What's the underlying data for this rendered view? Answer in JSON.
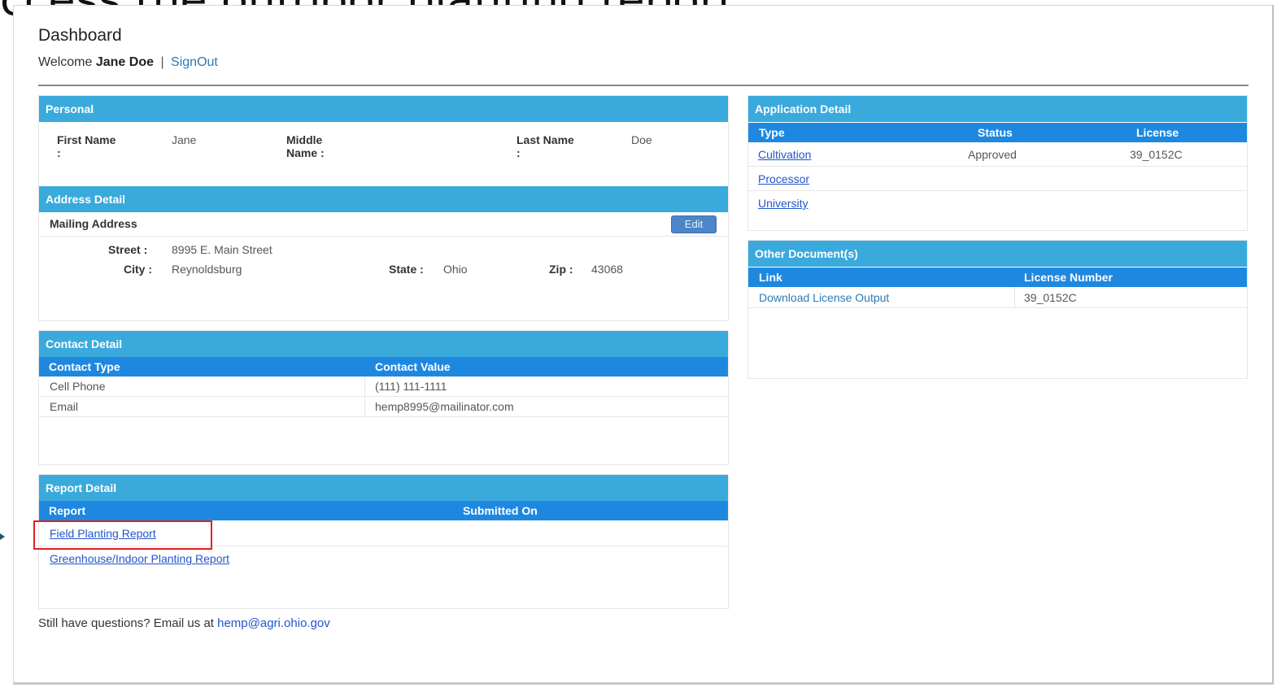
{
  "slide": {
    "title": "ccess the outdoor planting report."
  },
  "header": {
    "title": "Dashboard",
    "welcome_prefix": "Welcome",
    "user_name": "Jane Doe",
    "separator": "|",
    "signout": "SignOut"
  },
  "personal": {
    "heading": "Personal",
    "first_name_label": "First Name",
    "first_name_colon": ":",
    "first_name_value": "Jane",
    "middle_name_label": "Middle",
    "middle_name_label2": "Name :",
    "middle_name_value": "",
    "last_name_label": "Last Name",
    "last_name_colon": ":",
    "last_name_value": "Doe"
  },
  "address": {
    "heading": "Address Detail",
    "mailing_label": "Mailing Address",
    "edit_button": "Edit",
    "street_label": "Street :",
    "street_value": "8995 E. Main Street",
    "city_label": "City :",
    "city_value": "Reynoldsburg",
    "state_label": "State :",
    "state_value": "Ohio",
    "zip_label": "Zip :",
    "zip_value": "43068"
  },
  "contact": {
    "heading": "Contact Detail",
    "columns": [
      "Contact Type",
      "Contact Value"
    ],
    "rows": [
      {
        "type": "Cell Phone",
        "value": "(111) 111-1111"
      },
      {
        "type": "Email",
        "value": "hemp8995@mailinator.com"
      }
    ]
  },
  "report": {
    "heading": "Report Detail",
    "columns": [
      "Report",
      "Submitted On"
    ],
    "rows": [
      {
        "name": "Field Planting Report",
        "submitted": ""
      },
      {
        "name": "Greenhouse/Indoor Planting Report",
        "submitted": ""
      }
    ]
  },
  "application": {
    "heading": "Application Detail",
    "columns": [
      "Type",
      "Status",
      "License"
    ],
    "rows": [
      {
        "type": "Cultivation",
        "status": "Approved",
        "license": "39_0152C"
      },
      {
        "type": "Processor",
        "status": "",
        "license": ""
      },
      {
        "type": "University",
        "status": "",
        "license": ""
      }
    ]
  },
  "documents": {
    "heading": "Other Document(s)",
    "columns": [
      "Link",
      "License Number"
    ],
    "rows": [
      {
        "link": "Download License Output",
        "license_number": "39_0152C"
      }
    ]
  },
  "footer": {
    "text": "Still have questions? Email us at",
    "email": "hemp@agri.ohio.gov"
  },
  "colors": {
    "panel_header": "#3aaadc",
    "table_header": "#1e88e0",
    "highlight": "#e02020",
    "link": "#2255cc"
  }
}
